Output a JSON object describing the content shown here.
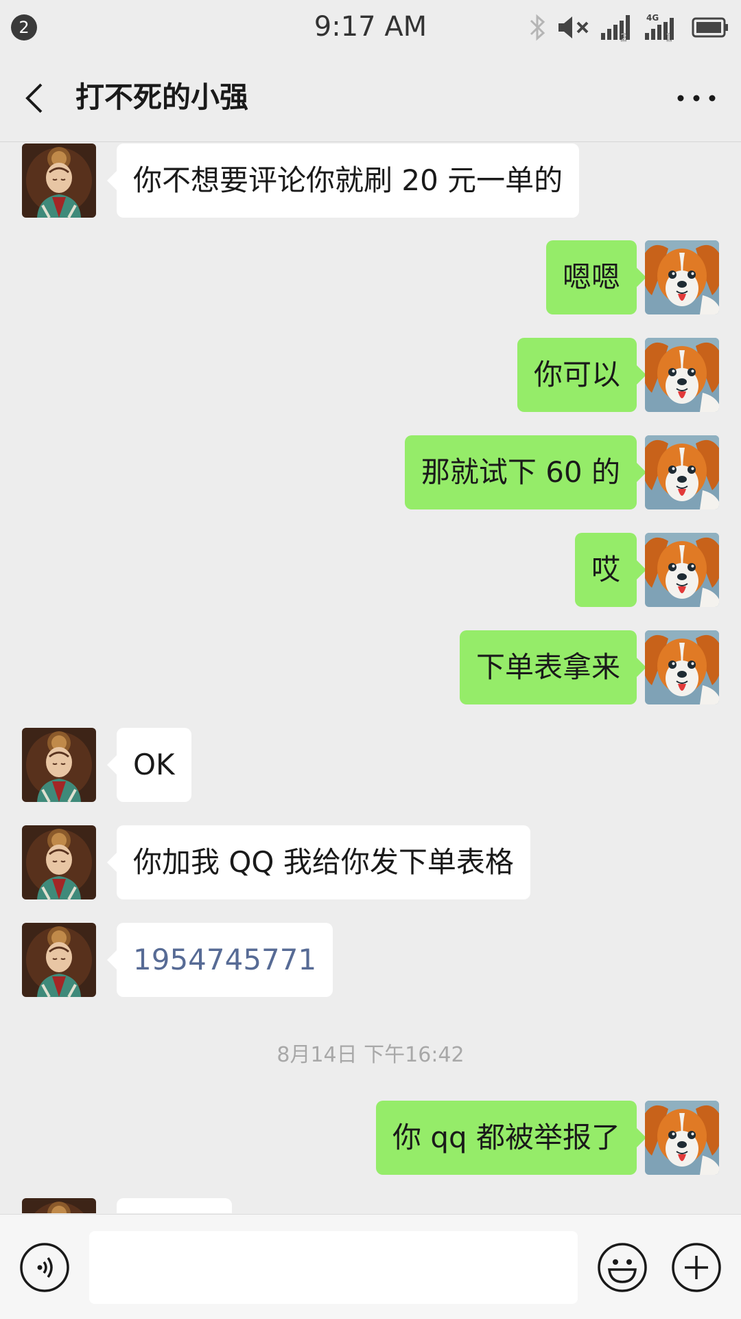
{
  "status_bar": {
    "notification_count": "2",
    "time": "9:17 AM",
    "network_label": "4G",
    "sim1": "2",
    "sim2": "1"
  },
  "header": {
    "title": "打不死的小强"
  },
  "messages": [
    {
      "side": "left",
      "text": "你不想要评论你就刷 20 元一单的"
    },
    {
      "side": "right",
      "text": "嗯嗯"
    },
    {
      "side": "right",
      "text": "你可以"
    },
    {
      "side": "right",
      "text": "那就试下 60 的"
    },
    {
      "side": "right",
      "text": "哎"
    },
    {
      "side": "right",
      "text": "下单表拿来"
    },
    {
      "side": "left",
      "text": "OK"
    },
    {
      "side": "left",
      "text": "你加我 QQ 我给你发下单表格"
    },
    {
      "side": "left",
      "text": "1954745771",
      "link": true
    },
    {
      "side": "right",
      "text": "你 qq 都被举报了"
    }
  ],
  "timestamp": "8月14日 下午16:42",
  "input": {
    "value": "",
    "placeholder": ""
  },
  "colors": {
    "sent_bubble": "#95ec69",
    "received_bubble": "#ffffff",
    "background": "#ededed",
    "link": "#576b95"
  }
}
